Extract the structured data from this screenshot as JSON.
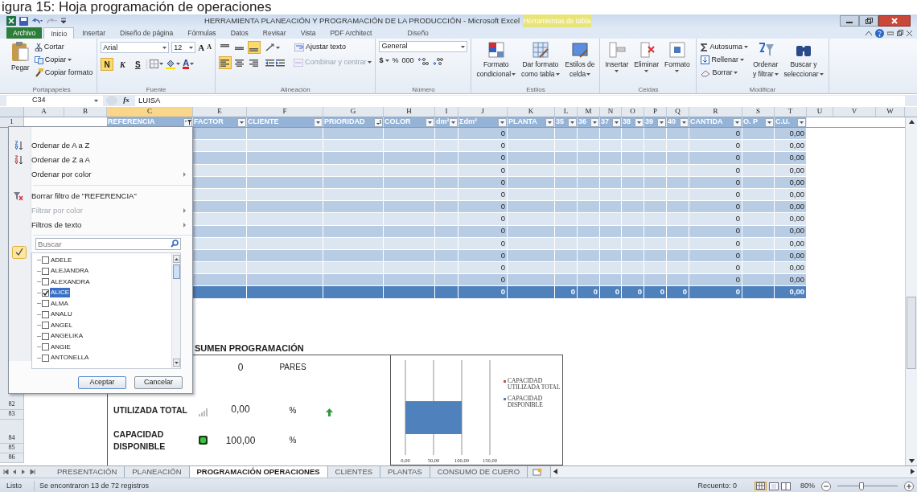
{
  "caption": "igura 15: Hoja programación de operaciones",
  "window": {
    "title": "HERRAMIENTA PLANEACIÓN Y PROGRAMACIÓN DE LA PRODUCCIÓN  -  Microsoft Excel",
    "context_label": "Herramientas de tabla"
  },
  "ribbon_tabs": [
    {
      "label": "Archivo",
      "kind": "file",
      "selected": false
    },
    {
      "label": "Inicio",
      "kind": "tab",
      "selected": true
    },
    {
      "label": "Insertar",
      "kind": "tab",
      "selected": false
    },
    {
      "label": "Diseño de página",
      "kind": "tab",
      "selected": false
    },
    {
      "label": "Fórmulas",
      "kind": "tab",
      "selected": false
    },
    {
      "label": "Datos",
      "kind": "tab",
      "selected": false
    },
    {
      "label": "Revisar",
      "kind": "tab",
      "selected": false
    },
    {
      "label": "Vista",
      "kind": "tab",
      "selected": false
    },
    {
      "label": "PDF Architect",
      "kind": "tab",
      "selected": false
    },
    {
      "label": "Diseño",
      "kind": "context",
      "selected": false
    }
  ],
  "ribbon": {
    "clipboard": {
      "label": "Portapapeles",
      "paste": "Pegar",
      "cut": "Cortar",
      "copy": "Copiar",
      "format_painter": "Copiar formato"
    },
    "font": {
      "label": "Fuente",
      "font": "Arial",
      "size": "12",
      "grow": "A",
      "shrink": "A",
      "bold": {
        "label": "N",
        "on": true
      },
      "italic": {
        "label": "K",
        "on": false
      },
      "underline": {
        "label": "S",
        "on": false
      },
      "font_color": "A"
    },
    "alignment": {
      "label": "Alineación",
      "align_top_on": false,
      "align_middle_on": false,
      "align_bottom_on": true,
      "align_left_on": true,
      "align_center_on": false,
      "align_right_on": false,
      "wrap": "Ajustar texto",
      "merge": {
        "label": "Combinar y centrar",
        "disabled": true
      }
    },
    "number": {
      "label": "Número",
      "format": "General",
      "currency": "$",
      "percent": "%",
      "thousands": "000"
    },
    "styles": {
      "label": "Estilos",
      "buttons": [
        {
          "line1": "Formato",
          "line2": "condicional"
        },
        {
          "line1": "Dar formato",
          "line2": "como tabla"
        },
        {
          "line1": "Estilos de",
          "line2": "celda"
        }
      ]
    },
    "cells": {
      "label": "Celdas",
      "buttons": [
        "Insertar",
        "Eliminar",
        "Formato"
      ]
    },
    "editing": {
      "label": "Modificar",
      "autosum": "Autosuma",
      "fill": "Rellenar",
      "clear": "Borrar",
      "sort": {
        "line1": "Ordenar",
        "line2": "y filtrar"
      },
      "find": {
        "line1": "Buscar y",
        "line2": "seleccionar"
      }
    }
  },
  "formula_bar": {
    "name_box": "C34",
    "fx": "fx",
    "value": "LUISA"
  },
  "columns": [
    {
      "letter": "A",
      "selected": false
    },
    {
      "letter": "B",
      "selected": false
    },
    {
      "letter": "C",
      "selected": true
    },
    {
      "letter": "E",
      "selected": false
    },
    {
      "letter": "F",
      "selected": false
    },
    {
      "letter": "G",
      "selected": false
    },
    {
      "letter": "H",
      "selected": false
    },
    {
      "letter": "I",
      "selected": false
    },
    {
      "letter": "J",
      "selected": false
    },
    {
      "letter": "K",
      "selected": false
    },
    {
      "letter": "L",
      "selected": false
    },
    {
      "letter": "M",
      "selected": false
    },
    {
      "letter": "N",
      "selected": false
    },
    {
      "letter": "O",
      "selected": false
    },
    {
      "letter": "P",
      "selected": false
    },
    {
      "letter": "Q",
      "selected": false
    },
    {
      "letter": "R",
      "selected": false
    },
    {
      "letter": "S",
      "selected": false
    },
    {
      "letter": "T",
      "selected": false
    },
    {
      "letter": "U",
      "selected": false
    },
    {
      "letter": "V",
      "selected": false
    },
    {
      "letter": "W",
      "selected": false
    }
  ],
  "header_row_number": "1",
  "table": {
    "columns": [
      {
        "label": "REFERENCIA",
        "filtered": true,
        "sorted": false
      },
      {
        "label": "FACTOR",
        "filtered": false,
        "sorted": false
      },
      {
        "label": "CLIENTE",
        "filtered": false,
        "sorted": false
      },
      {
        "label": "PRIORIDAD",
        "filtered": false,
        "sorted": true
      },
      {
        "label": "COLOR",
        "filtered": false,
        "sorted": false
      },
      {
        "label": "dm²",
        "filtered": false,
        "sorted": false
      },
      {
        "label": "Σdm²",
        "filtered": false,
        "sorted": false
      },
      {
        "label": "PLANTA",
        "filtered": false,
        "sorted": false
      },
      {
        "label": "35",
        "filtered": false,
        "sorted": false
      },
      {
        "label": "36",
        "filtered": false,
        "sorted": false
      },
      {
        "label": "37",
        "filtered": false,
        "sorted": false
      },
      {
        "label": "38",
        "filtered": false,
        "sorted": false
      },
      {
        "label": "39",
        "filtered": false,
        "sorted": false
      },
      {
        "label": "40",
        "filtered": false,
        "sorted": false
      },
      {
        "label": "CANTIDA",
        "filtered": false,
        "sorted": false
      },
      {
        "label": "O. P",
        "filtered": false,
        "sorted": false
      },
      {
        "label": "C.U.",
        "filtered": false,
        "sorted": false
      }
    ],
    "rows": [
      {
        "kind": "data",
        "cells": [
          null,
          null,
          null,
          null,
          null,
          null,
          "0",
          null,
          null,
          null,
          null,
          null,
          null,
          null,
          "0",
          null,
          "0,00"
        ]
      },
      {
        "kind": "data",
        "cells": [
          null,
          null,
          null,
          null,
          null,
          null,
          "0",
          null,
          null,
          null,
          null,
          null,
          null,
          null,
          "0",
          null,
          "0,00"
        ]
      },
      {
        "kind": "data",
        "cells": [
          null,
          null,
          null,
          null,
          null,
          null,
          "0",
          null,
          null,
          null,
          null,
          null,
          null,
          null,
          "0",
          null,
          "0,00"
        ]
      },
      {
        "kind": "data",
        "cells": [
          null,
          null,
          null,
          null,
          null,
          null,
          "0",
          null,
          null,
          null,
          null,
          null,
          null,
          null,
          "0",
          null,
          "0,00"
        ]
      },
      {
        "kind": "data",
        "cells": [
          null,
          null,
          null,
          null,
          null,
          null,
          "0",
          null,
          null,
          null,
          null,
          null,
          null,
          null,
          "0",
          null,
          "0,00"
        ]
      },
      {
        "kind": "data",
        "cells": [
          null,
          null,
          null,
          null,
          null,
          null,
          "0",
          null,
          null,
          null,
          null,
          null,
          null,
          null,
          "0",
          null,
          "0,00"
        ]
      },
      {
        "kind": "data",
        "cells": [
          null,
          null,
          null,
          null,
          null,
          null,
          "0",
          null,
          null,
          null,
          null,
          null,
          null,
          null,
          "0",
          null,
          "0,00"
        ]
      },
      {
        "kind": "data",
        "cells": [
          null,
          null,
          null,
          null,
          null,
          null,
          "0",
          null,
          null,
          null,
          null,
          null,
          null,
          null,
          "0",
          null,
          "0,00"
        ]
      },
      {
        "kind": "data",
        "cells": [
          null,
          null,
          null,
          null,
          null,
          null,
          "0",
          null,
          null,
          null,
          null,
          null,
          null,
          null,
          "0",
          null,
          "0,00"
        ]
      },
      {
        "kind": "data",
        "cells": [
          null,
          null,
          null,
          null,
          null,
          null,
          "0",
          null,
          null,
          null,
          null,
          null,
          null,
          null,
          "0",
          null,
          "0,00"
        ]
      },
      {
        "kind": "data",
        "cells": [
          null,
          null,
          null,
          null,
          null,
          null,
          "0",
          null,
          null,
          null,
          null,
          null,
          null,
          null,
          "0",
          null,
          "0,00"
        ]
      },
      {
        "kind": "data",
        "cells": [
          null,
          null,
          null,
          null,
          null,
          null,
          "0",
          null,
          null,
          null,
          null,
          null,
          null,
          null,
          "0",
          null,
          "0,00"
        ]
      },
      {
        "kind": "data",
        "cells": [
          null,
          null,
          null,
          null,
          null,
          null,
          "0",
          null,
          null,
          null,
          null,
          null,
          null,
          null,
          "0",
          null,
          "0,00"
        ]
      },
      {
        "kind": "total",
        "cells": [
          null,
          null,
          null,
          null,
          null,
          null,
          "0",
          null,
          "0",
          "0",
          "0",
          "0",
          "0",
          "0",
          "0",
          null,
          "0,00"
        ]
      }
    ]
  },
  "filter_menu": {
    "items": [
      {
        "label": "Ordenar de A a Z",
        "submenu": false,
        "disabled": false
      },
      {
        "label": "Ordenar de Z a A",
        "submenu": false,
        "disabled": false
      },
      {
        "label": "Ordenar por color",
        "submenu": true,
        "disabled": false
      },
      {
        "label": "Borrar filtro de \"REFERENCIA\"",
        "submenu": false,
        "disabled": false
      },
      {
        "label": "Filtrar por color",
        "submenu": true,
        "disabled": true
      },
      {
        "label": "Filtros de texto",
        "submenu": true,
        "disabled": false
      }
    ],
    "search": {
      "placeholder": "Buscar"
    },
    "values": [
      {
        "label": "ADELE",
        "checked": false,
        "selected": false
      },
      {
        "label": "ALEJANDRA",
        "checked": false,
        "selected": false
      },
      {
        "label": "ALEXANDRA",
        "checked": false,
        "selected": false
      },
      {
        "label": "ALICE",
        "checked": true,
        "selected": true
      },
      {
        "label": "ALMA",
        "checked": false,
        "selected": false
      },
      {
        "label": "ANALU",
        "checked": false,
        "selected": false
      },
      {
        "label": "ANGEL",
        "checked": false,
        "selected": false
      },
      {
        "label": "ANGELIKA",
        "checked": false,
        "selected": false
      },
      {
        "label": "ANGIE",
        "checked": false,
        "selected": false
      },
      {
        "label": "ANTONELLA",
        "checked": false,
        "selected": false
      }
    ],
    "buttons": [
      "Aceptar",
      "Cancelar"
    ]
  },
  "row_numbers": [
    "82",
    "83",
    "84",
    "85",
    "86"
  ],
  "summary": {
    "title": "SUMEN PROGRAMACIÓN",
    "rows": [
      {
        "kind": "plain",
        "value": "0",
        "unit": "PARES"
      },
      {
        "kind": "trend",
        "label": "UTILIZADA TOTAL",
        "value": "0,00",
        "unit": "%"
      },
      {
        "kind": "status",
        "label": "CAPACIDAD DISPONIBLE",
        "value": "100,00",
        "unit": "%"
      }
    ],
    "chart_data": {
      "type": "bar",
      "orientation": "horizontal",
      "stacked": true,
      "series": [
        {
          "name": "CAPACIDAD UTILIZADA TOTAL",
          "color": "#c0504d",
          "values": [
            0
          ]
        },
        {
          "name": "CAPACIDAD DISPONIBLE",
          "color": "#4f81bd",
          "values": [
            100
          ]
        }
      ],
      "xlim": [
        0,
        150
      ],
      "xticks": [
        {
          "value": 0,
          "label": "0,00"
        },
        {
          "value": 50,
          "label": "50,00"
        },
        {
          "value": 100,
          "label": "100,00"
        },
        {
          "value": 150,
          "label": "150,00"
        }
      ]
    }
  },
  "sheet_tabs": [
    {
      "label": "PRESENTACIÓN",
      "selected": false
    },
    {
      "label": "PLANEACIÓN",
      "selected": false
    },
    {
      "label": "PROGRAMACIÓN OPERACIONES",
      "selected": true
    },
    {
      "label": "CLIENTES",
      "selected": false
    },
    {
      "label": "PLANTAS",
      "selected": false
    },
    {
      "label": "CONSUMO DE CUERO",
      "selected": false
    }
  ],
  "status_bar": {
    "mode": "Listo",
    "message": "Se encontraron 13 de 72 registros",
    "count": "Recuento: 0",
    "zoom": "80%",
    "zoom_slider": {
      "level": 0.4
    }
  }
}
